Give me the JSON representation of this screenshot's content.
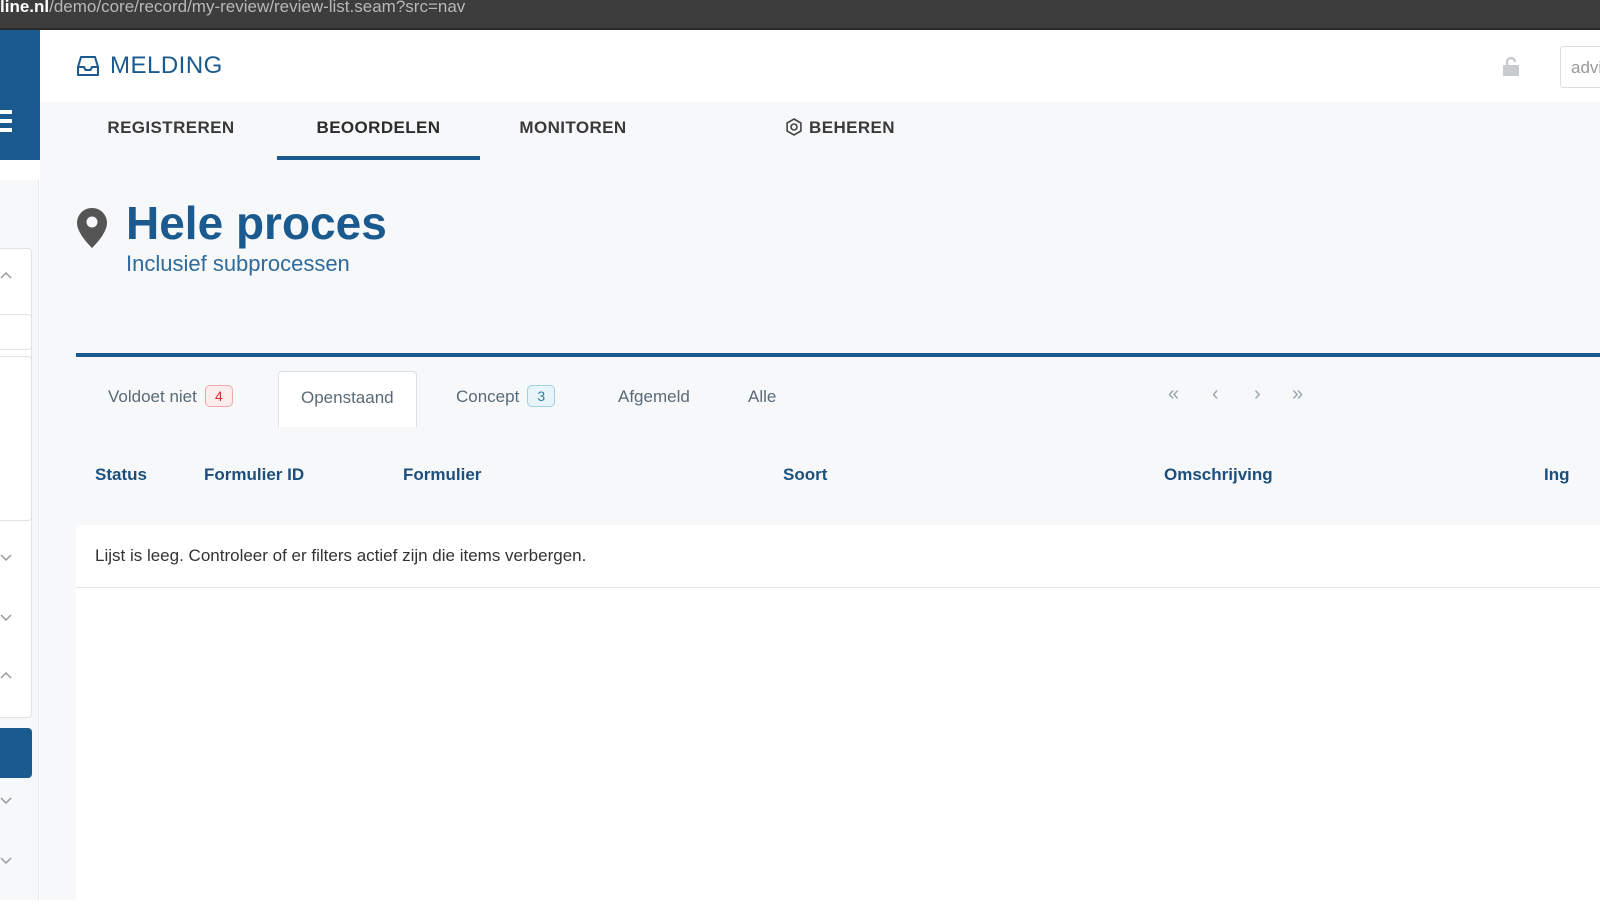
{
  "browser": {
    "url_host": "line.nl",
    "url_path": "/demo/core/record/my-review/review-list.seam?src=nav"
  },
  "header": {
    "app_title": "MELDING",
    "user_field_value": "advi"
  },
  "nav": {
    "items": [
      {
        "label": "REGISTREREN",
        "active": false
      },
      {
        "label": "BEOORDELEN",
        "active": true
      },
      {
        "label": "MONITOREN",
        "active": false
      },
      {
        "label": "BEHEREN",
        "active": false,
        "icon": "gear-icon"
      }
    ]
  },
  "page": {
    "title": "Hele proces",
    "subtitle": "Inclusief subprocessen"
  },
  "filters": {
    "tabs": [
      {
        "label": "Voldoet niet",
        "badge": "4",
        "badge_color": "#c9302c"
      },
      {
        "label": "Openstaand",
        "active": true
      },
      {
        "label": "Concept",
        "badge": "3",
        "badge_color": "#2f7ea3"
      },
      {
        "label": "Afgemeld"
      },
      {
        "label": "Alle"
      }
    ]
  },
  "pager": {
    "first": "«",
    "prev": "‹",
    "next": "›",
    "last": "»"
  },
  "table": {
    "columns": [
      "Status",
      "Formulier ID",
      "Formulier",
      "Soort",
      "Omschrijving",
      "Ing"
    ],
    "empty_message": "Lijst is leeg. Controleer of er filters actief zijn die items verbergen."
  },
  "colors": {
    "brand": "#1b5a8e",
    "background": "#f6f8fa"
  }
}
